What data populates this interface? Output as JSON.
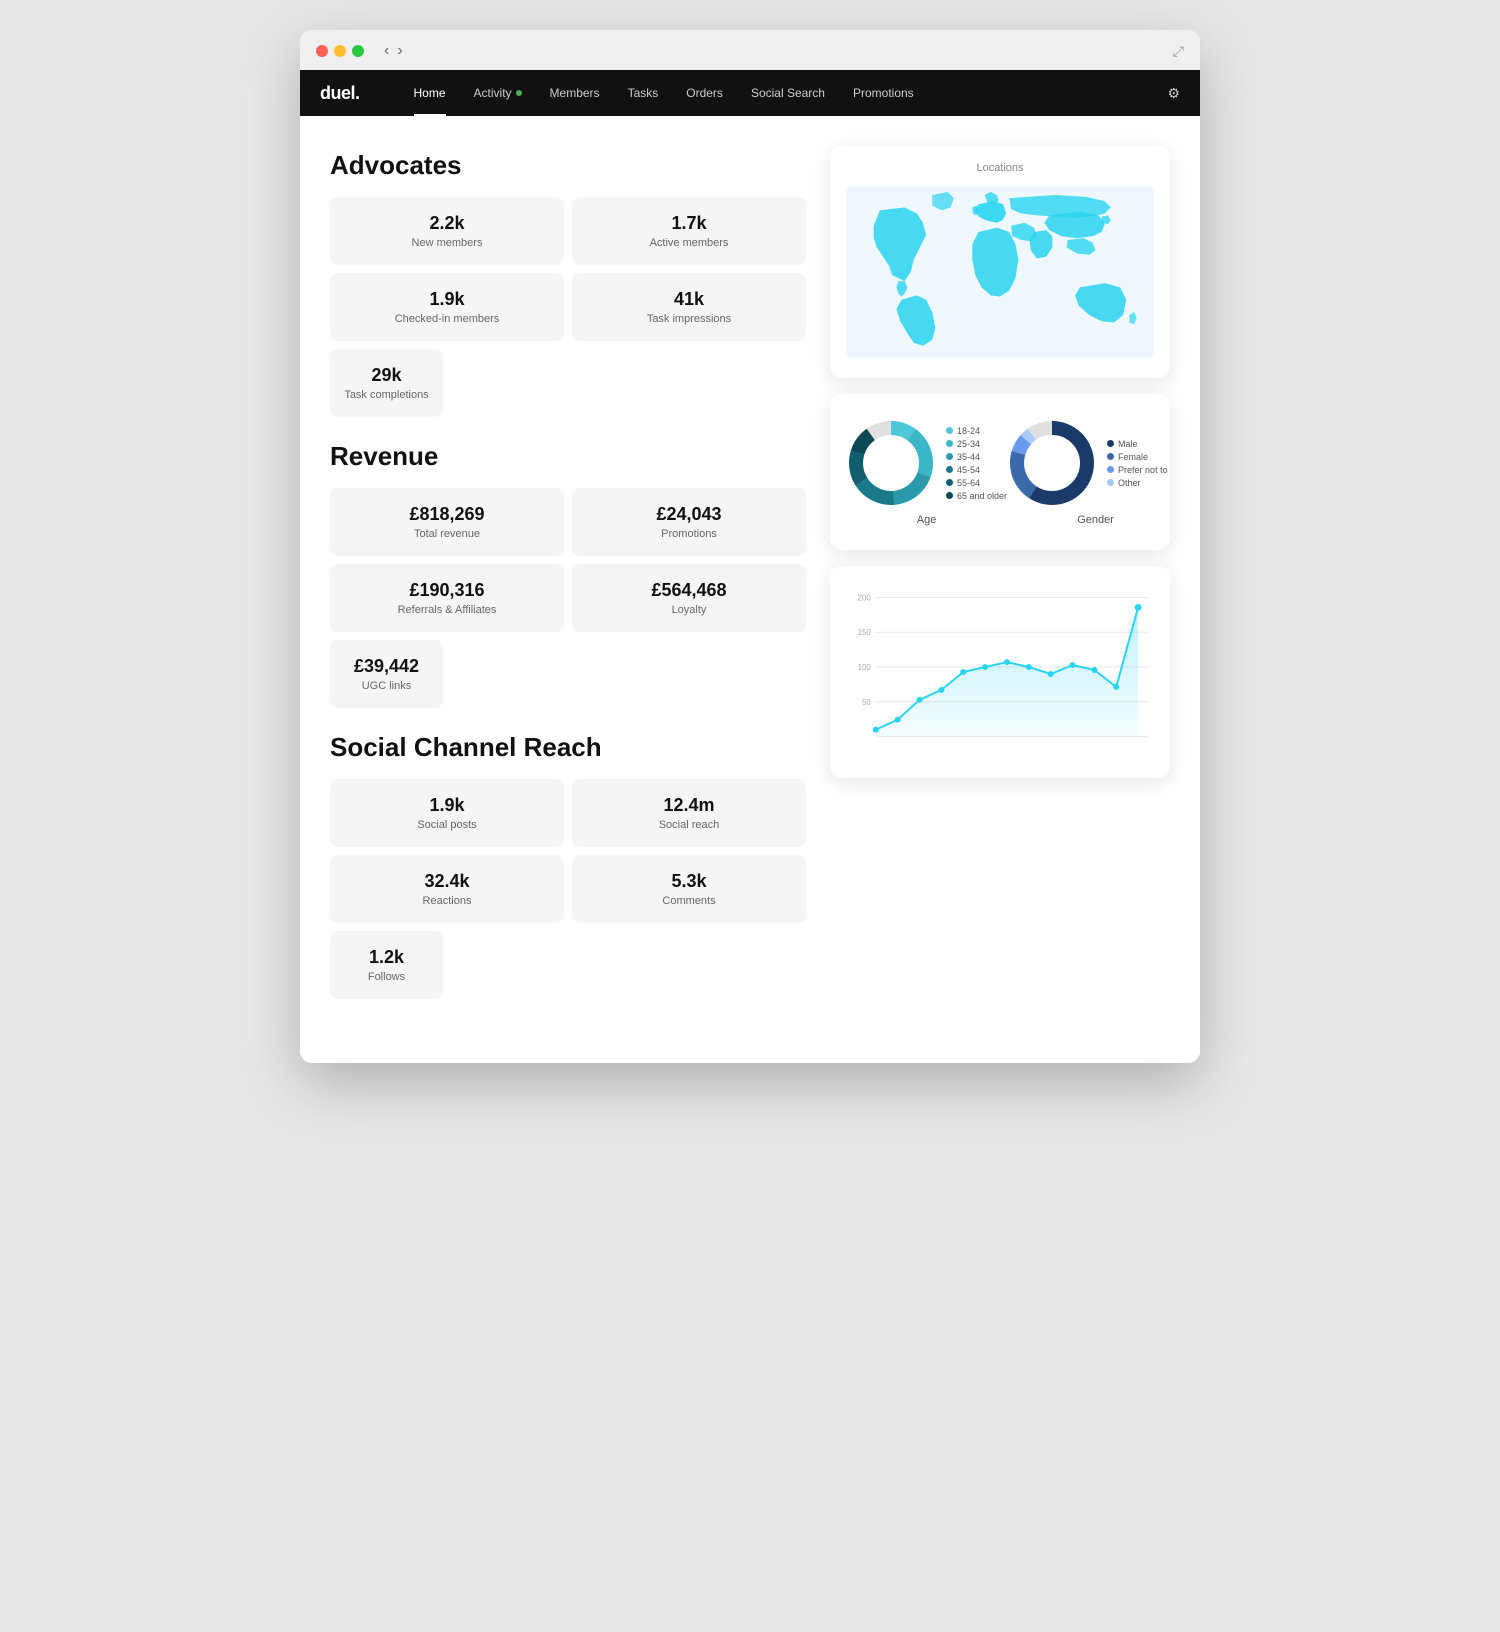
{
  "browser": {
    "expand_icon": "⤢"
  },
  "nav": {
    "logo": "duel.",
    "items": [
      {
        "id": "home",
        "label": "Home",
        "active": true,
        "dot": false
      },
      {
        "id": "activity",
        "label": "Activity",
        "active": false,
        "dot": true
      },
      {
        "id": "members",
        "label": "Members",
        "active": false,
        "dot": false
      },
      {
        "id": "tasks",
        "label": "Tasks",
        "active": false,
        "dot": false
      },
      {
        "id": "orders",
        "label": "Orders",
        "active": false,
        "dot": false
      },
      {
        "id": "social-search",
        "label": "Social Search",
        "active": false,
        "dot": false
      },
      {
        "id": "promotions",
        "label": "Promotions",
        "active": false,
        "dot": false
      }
    ],
    "gear_icon": "⚙"
  },
  "advocates": {
    "title": "Advocates",
    "stats": [
      {
        "value": "2.2k",
        "label": "New members"
      },
      {
        "value": "1.7k",
        "label": "Active members"
      },
      {
        "value": "1.9k",
        "label": "Checked-in members"
      },
      {
        "value": "41k",
        "label": "Task impressions"
      },
      {
        "value": "29k",
        "label": "Task completions"
      }
    ]
  },
  "revenue": {
    "title": "Revenue",
    "stats": [
      {
        "value": "£818,269",
        "label": "Total revenue"
      },
      {
        "value": "£24,043",
        "label": "Promotions"
      },
      {
        "value": "£190,316",
        "label": "Referrals & Affiliates"
      },
      {
        "value": "£564,468",
        "label": "Loyalty"
      },
      {
        "value": "£39,442",
        "label": "UGC links"
      }
    ]
  },
  "social_channel_reach": {
    "title": "Social Channel Reach",
    "stats": [
      {
        "value": "1.9k",
        "label": "Social posts"
      },
      {
        "value": "12.4m",
        "label": "Social reach"
      },
      {
        "value": "32.4k",
        "label": "Reactions"
      },
      {
        "value": "5.3k",
        "label": "Comments"
      },
      {
        "value": "1.2k",
        "label": "Follows"
      }
    ]
  },
  "locations_card": {
    "title": "Locations"
  },
  "age_gender_card": {
    "age_label": "Age",
    "gender_label": "Gender",
    "age_legend": [
      {
        "label": "18-24",
        "color": "#4ec8d8"
      },
      {
        "label": "25-34",
        "color": "#3ab8c8"
      },
      {
        "label": "35-44",
        "color": "#2a9aaa"
      },
      {
        "label": "45-54",
        "color": "#1a7a8a"
      },
      {
        "label": "55-64",
        "color": "#0f5f6f"
      },
      {
        "label": "65 and older",
        "color": "#0a4a55"
      }
    ],
    "gender_legend": [
      {
        "label": "Male",
        "color": "#1a3a6a"
      },
      {
        "label": "Female",
        "color": "#3a6aaa"
      },
      {
        "label": "Prefer not to say",
        "color": "#6a9aee"
      },
      {
        "label": "Other",
        "color": "#aacaff"
      }
    ]
  },
  "line_chart_card": {
    "y_labels": [
      "200",
      "150",
      "100",
      "50"
    ]
  }
}
